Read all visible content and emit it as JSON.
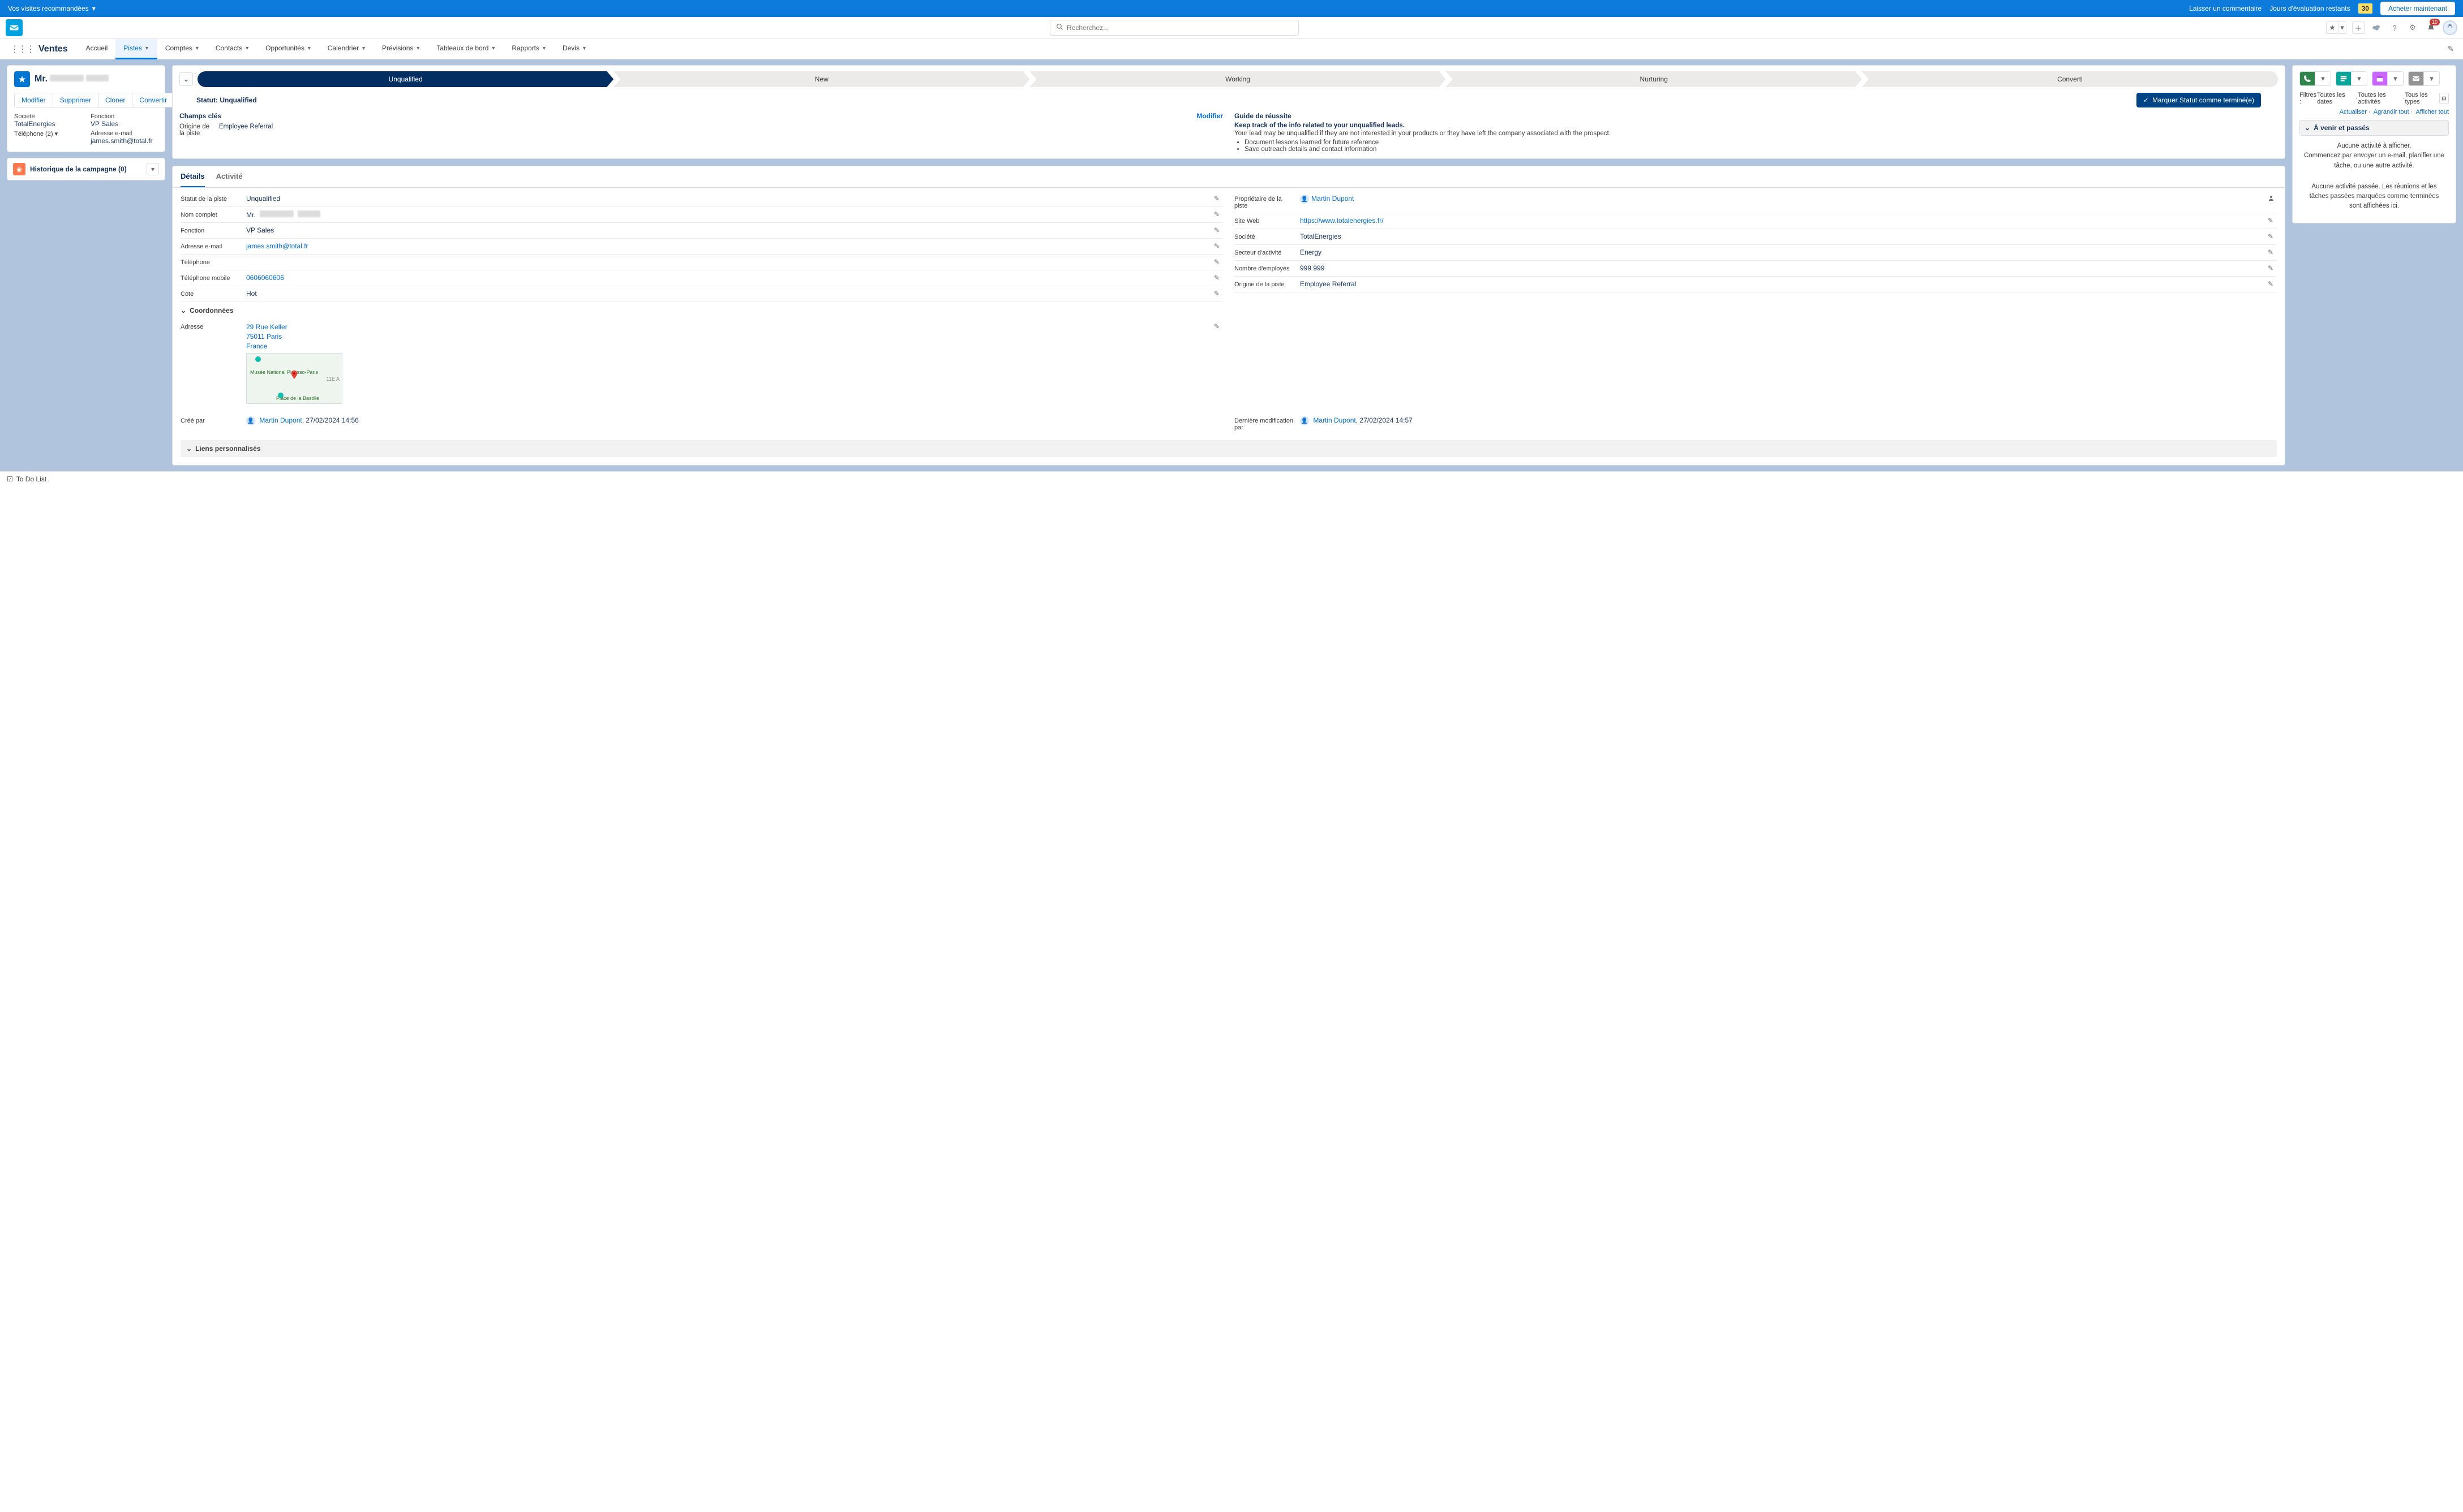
{
  "banner": {
    "left": "Vos visites recommandées",
    "comment": "Laisser un commentaire",
    "trial": "Jours d'évaluation restants",
    "days": "30",
    "buy": "Acheter maintenant"
  },
  "search": {
    "placeholder": "Recherchez..."
  },
  "appName": "Ventes",
  "notificationCount": "10",
  "nav": {
    "items": [
      "Accueil",
      "Pistes",
      "Comptes",
      "Contacts",
      "Opportunités",
      "Calendrier",
      "Prévisions",
      "Tableaux de bord",
      "Rapports",
      "Devis"
    ],
    "activeIndex": 1
  },
  "record": {
    "title": "Mr.",
    "actions": [
      "Modifier",
      "Supprimer",
      "Cloner",
      "Convertir"
    ],
    "fields": {
      "societeLabel": "Société",
      "societe": "TotalEnergies",
      "fonctionLabel": "Fonction",
      "fonction": "VP Sales",
      "telLabel": "Téléphone (2)",
      "emailLabel": "Adresse e-mail",
      "email": "james.smith@total.fr"
    }
  },
  "campaign": {
    "title": "Historique de la campagne (0)"
  },
  "path": {
    "stages": [
      "Unqualified",
      "New",
      "Working",
      "Nurturing",
      "Converti"
    ],
    "currentIndex": 0,
    "statusPrefix": "Statut:",
    "statusValue": "Unqualified",
    "markBtn": "Marquer Statut comme terminé(e)",
    "keyFieldsTitle": "Champs clés",
    "modify": "Modifier",
    "originLabel": "Origine de la piste",
    "originValue": "Employee Referral",
    "guideTitle": "Guide de réussite",
    "guideLead": "Keep track of the info related to your unqualified leads.",
    "guideBody": "Your lead may be unqualified if they are not interested in your products or they have left the company associated with the prospect.",
    "guideBullets": [
      "Document lessons learned for future reference",
      "Save outreach details and contact information"
    ]
  },
  "tabs": {
    "details": "Détails",
    "activity": "Activité"
  },
  "details": {
    "left": [
      {
        "label": "Statut de la piste",
        "value": "Unqualified",
        "edit": true
      },
      {
        "label": "Nom complet",
        "value": "Mr.",
        "blurred": true,
        "edit": true
      },
      {
        "label": "Fonction",
        "value": "VP Sales",
        "edit": true
      },
      {
        "label": "Adresse e-mail",
        "value": "james.smith@total.fr",
        "link": true,
        "edit": true
      },
      {
        "label": "Téléphone",
        "value": "",
        "edit": true
      },
      {
        "label": "Téléphone mobile",
        "value": "0606060606",
        "link": true,
        "edit": true
      },
      {
        "label": "Cote",
        "value": "Hot",
        "edit": true
      }
    ],
    "right": [
      {
        "label": "Propriétaire de la piste",
        "value": "Martin Dupont",
        "owner": true,
        "ownerIcon": true
      },
      {
        "label": "Site Web",
        "value": "https://www.totalenergies.fr/",
        "link": true,
        "edit": true
      },
      {
        "label": "Société",
        "value": "TotalEnergies",
        "edit": true
      },
      {
        "label": "Secteur d'activité",
        "value": "Energy",
        "edit": true
      },
      {
        "label": "Nombre d'employés",
        "value": "999 999",
        "edit": true
      },
      {
        "label": "Origine de la piste",
        "value": "Employee Referral",
        "edit": true
      }
    ]
  },
  "coord": {
    "title": "Coordonnées",
    "addressLabel": "Adresse",
    "address": [
      "29 Rue Keller",
      "75011 Paris",
      "France"
    ],
    "mapLabels": [
      "Musée National Picasso-Paris",
      "Place de la Bastille",
      "11E A"
    ]
  },
  "audit": {
    "createdByLabel": "Créé par",
    "createdBy": "Martin Dupont",
    "createdAt": "27/02/2024 14:56",
    "modifiedByLabel": "Dernière modification par",
    "modifiedBy": "Martin Dupont",
    "modifiedAt": "27/02/2024 14:57"
  },
  "customLinks": "Liens personnalisés",
  "activities": {
    "filterPrefix": "Filtres : ",
    "filterParts": [
      "Toutes les dates",
      "Toutes les activités",
      "Tous les types"
    ],
    "links": [
      "Actualiser",
      "Agrandir tout",
      "Afficher tout"
    ],
    "sectionTitle": "À venir et passés",
    "emptyUpcoming": "Aucune activité à afficher.\nCommencez par envoyer un e-mail, planifier une tâche, ou une autre activité.",
    "emptyPast": "Aucune activité passée. Les réunions et les tâches passées marquées comme terminées sont affichées ici."
  },
  "footer": {
    "todo": "To Do List"
  }
}
